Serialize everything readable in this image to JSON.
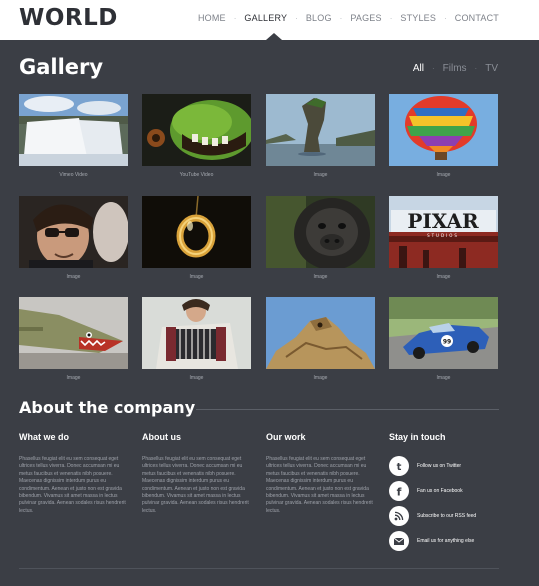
{
  "logo": "WORLD",
  "nav": [
    {
      "label": "HOME",
      "active": false
    },
    {
      "label": "GALLERY",
      "active": true
    },
    {
      "label": "BLOG",
      "active": false
    },
    {
      "label": "PAGES",
      "active": false
    },
    {
      "label": "STYLES",
      "active": false
    },
    {
      "label": "CONTACT",
      "active": false
    }
  ],
  "gallery": {
    "title": "Gallery",
    "filters": [
      {
        "label": "All",
        "active": true
      },
      {
        "label": "Films",
        "active": false
      },
      {
        "label": "TV",
        "active": false
      }
    ],
    "items": [
      {
        "caption": "Vimeo Video",
        "subject": "waterfall"
      },
      {
        "caption": "YouTube Video",
        "subject": "green-monster"
      },
      {
        "caption": "Image",
        "subject": "rock-island"
      },
      {
        "caption": "Image",
        "subject": "hot-air-balloon"
      },
      {
        "caption": "Image",
        "subject": "man-with-glasses"
      },
      {
        "caption": "Image",
        "subject": "gold-ring"
      },
      {
        "caption": "Image",
        "subject": "gorilla"
      },
      {
        "caption": "Image",
        "subject": "pixar-sign"
      },
      {
        "caption": "Image",
        "subject": "shark-nose-plane"
      },
      {
        "caption": "Image",
        "subject": "accordion-player"
      },
      {
        "caption": "Image",
        "subject": "stone-creature"
      },
      {
        "caption": "Image",
        "subject": "blue-race-car"
      }
    ],
    "pixar_text": "PIXAR",
    "pixar_sub": "STUDIOS",
    "car_number": "99"
  },
  "about": {
    "title": "About the company",
    "columns": [
      {
        "title": "What we do",
        "text": "Phasellus feugiat elit eu sem consequat eget ultrices tellus viverra. Donec accumsan mi eu metus faucibus et venenatis nibh posuere. Maecenas dignissim interdum purus eu condimentum. Aenean et justo non est gravida bibendum. Vivamus sit amet massa in lectus pulvinar gravida. Aenean sodales risus hendrerit lectus."
      },
      {
        "title": "About us",
        "text": "Phasellus feugiat elit eu sem consequat eget ultrices tellus viverra. Donec accumsan mi eu metus faucibus et venenatis nibh posuere. Maecenas dignissim interdum purus eu condimentum. Aenean et justo non est gravida bibendum. Vivamus sit amet massa in lectus pulvinar gravida. Aenean sodales risus hendrerit lectus."
      },
      {
        "title": "Our work",
        "text": "Phasellus feugiat elit eu sem consequat eget ultrices tellus viverra. Donec accumsan mi eu metus faucibus et venenatis nibh posuere. Maecenas dignissim interdum purus eu condimentum. Aenean et justo non est gravida bibendum. Vivamus sit amet massa in lectus pulvinar gravida. Aenean sodales risus hendrerit lectus."
      }
    ]
  },
  "stay_in_touch": {
    "title": "Stay in touch",
    "links": [
      {
        "label": "Follow us on Twitter",
        "icon": "twitter-icon"
      },
      {
        "label": "Fan us on Facebook",
        "icon": "facebook-icon"
      },
      {
        "label": "Subscribe to our RSS feed",
        "icon": "rss-icon"
      },
      {
        "label": "Email us for anything else",
        "icon": "email-icon"
      }
    ]
  },
  "colors": {
    "background": "#3b3e45",
    "header": "#ffffff",
    "accent": "#ffffff",
    "muted_text": "#9ea2aa"
  }
}
